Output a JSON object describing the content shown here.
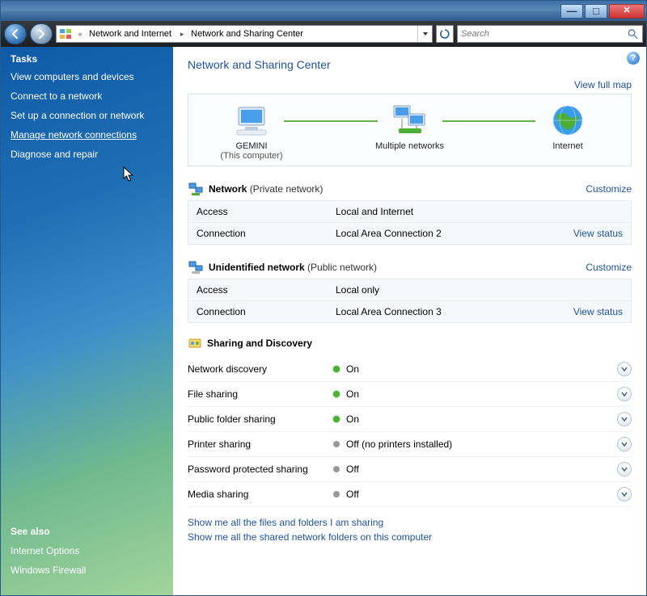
{
  "titlebar": {
    "min": "—",
    "max": "□",
    "close": "✕"
  },
  "nav": {
    "breadcrumb_prefix": "«",
    "crumb1": "Network and Internet",
    "crumb2": "Network and Sharing Center",
    "search_placeholder": "Search"
  },
  "sidebar": {
    "tasks_heading": "Tasks",
    "items": [
      "View computers and devices",
      "Connect to a network",
      "Set up a connection or network",
      "Manage network connections",
      "Diagnose and repair"
    ],
    "seealso_heading": "See also",
    "seealso": [
      "Internet Options",
      "Windows Firewall"
    ]
  },
  "main": {
    "title": "Network and Sharing Center",
    "view_full_map": "View full map",
    "nodes": {
      "computer": {
        "label": "GEMINI",
        "sub": "(This computer)"
      },
      "networks": {
        "label": "Multiple networks"
      },
      "internet": {
        "label": "Internet"
      }
    },
    "customize": "Customize",
    "view_status": "View status",
    "networks": [
      {
        "name": "Network",
        "type": "(Private network)",
        "access_k": "Access",
        "access_v": "Local and Internet",
        "conn_k": "Connection",
        "conn_v": "Local Area Connection 2"
      },
      {
        "name": "Unidentified network",
        "type": "(Public network)",
        "access_k": "Access",
        "access_v": "Local only",
        "conn_k": "Connection",
        "conn_v": "Local Area Connection 3"
      }
    ],
    "sharing_title": "Sharing and Discovery",
    "sharing": [
      {
        "k": "Network discovery",
        "v": "On",
        "on": true
      },
      {
        "k": "File sharing",
        "v": "On",
        "on": true
      },
      {
        "k": "Public folder sharing",
        "v": "On",
        "on": true
      },
      {
        "k": "Printer sharing",
        "v": "Off (no printers installed)",
        "on": false
      },
      {
        "k": "Password protected sharing",
        "v": "Off",
        "on": false
      },
      {
        "k": "Media sharing",
        "v": "Off",
        "on": false
      }
    ],
    "links": [
      "Show me all the files and folders I am sharing",
      "Show me all the shared network folders on this computer"
    ]
  }
}
